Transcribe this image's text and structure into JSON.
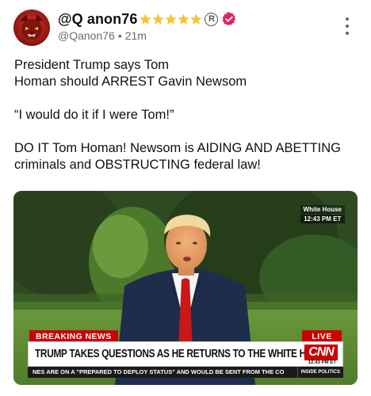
{
  "author": {
    "display_name": "@Q anon76",
    "handle": "@Qanon76",
    "separator": "•",
    "time_ago": "21m",
    "star_count": 5,
    "registered_mark": "R",
    "avatar_icon": "red-wolf-avatar-icon",
    "verified_icon": "verified-badge-icon",
    "verified_color": "#e0245e"
  },
  "post": {
    "lines": [
      "President Trump says Tom",
      "Homan should ARREST Gavin Newsom",
      "",
      "“I would do it if I were Tom!”",
      "",
      "DO IT Tom Homan! Newsom is AIDING AND ABETTING",
      "criminals and OBSTRUCTING federal law!"
    ]
  },
  "media": {
    "location_tag": "White House",
    "location_time": "12:43 PM ET",
    "breaking_label": "BREAKING NEWS",
    "live_label": "LIVE",
    "headline": "TRUMP TAKES QUESTIONS AS HE RETURNS TO THE WHITE HOUSE",
    "network_logo": "CNN",
    "network_time": "12:43 PM ET",
    "ticker": "NES ARE ON A \"PREPARED TO DEPLOY STATUS\" AND WOULD BE SENT FROM THE CO",
    "ticker_tag": "INSIDE POLITICS",
    "brand_red": "#cc0000"
  }
}
